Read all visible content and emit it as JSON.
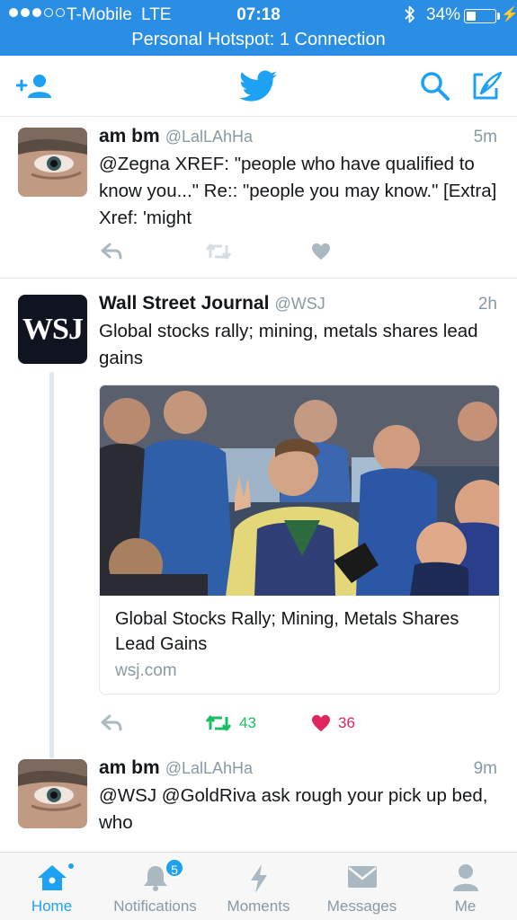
{
  "status_bar": {
    "carrier": "T-Mobile",
    "network": "LTE",
    "time": "07:18",
    "battery_percent": "34%",
    "battery_level": 0.34,
    "hotspot": "Personal Hotspot: 1 Connection"
  },
  "colors": {
    "accent": "#1da1f2",
    "status_bar": "#2a8ee5",
    "retweet_green": "#17bf63",
    "like_red": "#e0245e",
    "muted": "#8899a6"
  },
  "nav": {
    "icons": [
      "add-user-icon",
      "twitter-bird-icon",
      "search-icon",
      "compose-icon"
    ]
  },
  "tweets": [
    {
      "name": "am bm",
      "handle": "@LalLAhHa",
      "time": "5m",
      "text": "@Zegna XREF: \"people who have qualified to know you...\" Re:: \"people you may know.\" [Extra] Xref: 'might"
    },
    {
      "name": "Wall Street Journal",
      "handle": "@WSJ",
      "time": "2h",
      "avatar_text": "WSJ",
      "text": "Global stocks rally; mining, metals shares lead gains",
      "card": {
        "title": "Global Stocks Rally; Mining, Metals Shares Lead Gains",
        "domain": "wsj.com"
      },
      "retweets": "43",
      "likes": "36"
    },
    {
      "name": "am bm",
      "handle": "@LalLAhHa",
      "time": "9m",
      "text": "@WSJ @GoldRiva ask rough your pick up bed, who"
    }
  ],
  "tabbar": {
    "tabs": [
      {
        "label": "Home",
        "icon": "home-icon",
        "active": true
      },
      {
        "label": "Notifications",
        "icon": "bell-icon",
        "badge": "5"
      },
      {
        "label": "Moments",
        "icon": "lightning-icon"
      },
      {
        "label": "Messages",
        "icon": "envelope-icon"
      },
      {
        "label": "Me",
        "icon": "person-icon"
      }
    ]
  }
}
